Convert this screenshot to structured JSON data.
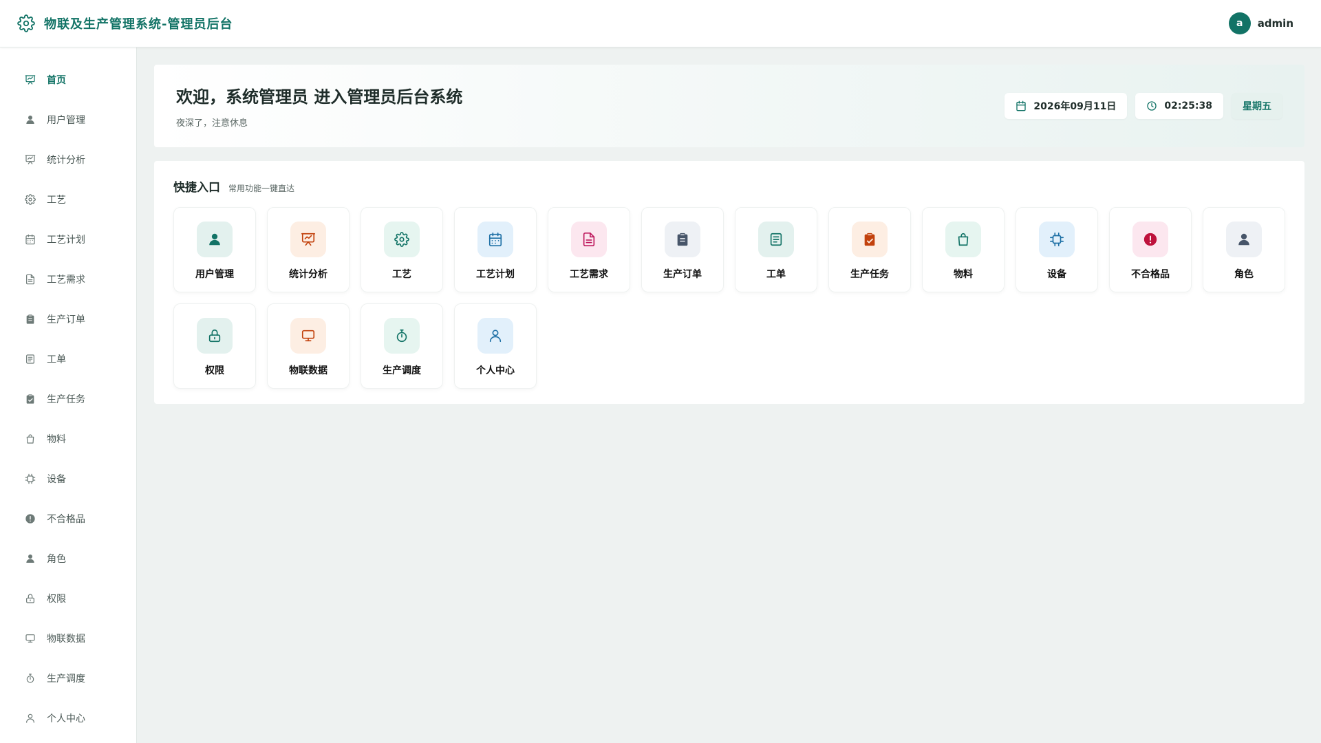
{
  "app": {
    "title": "物联及生产管理系统-管理员后台",
    "logo_icon": "gear-icon"
  },
  "user": {
    "avatar_letter": "a",
    "name": "admin"
  },
  "sidebar": {
    "items": [
      {
        "label": "首页",
        "icon": "presentation-icon",
        "active": true
      },
      {
        "label": "用户管理",
        "icon": "user-icon"
      },
      {
        "label": "统计分析",
        "icon": "presentation-icon"
      },
      {
        "label": "工艺",
        "icon": "gear-icon"
      },
      {
        "label": "工艺计划",
        "icon": "calendar-icon"
      },
      {
        "label": "工艺需求",
        "icon": "document-icon"
      },
      {
        "label": "生产订单",
        "icon": "clipboard-icon"
      },
      {
        "label": "工单",
        "icon": "list-doc-icon"
      },
      {
        "label": "生产任务",
        "icon": "clipboard-check-icon"
      },
      {
        "label": "物料",
        "icon": "bag-icon"
      },
      {
        "label": "设备",
        "icon": "chip-icon"
      },
      {
        "label": "不合格品",
        "icon": "alert-icon"
      },
      {
        "label": "角色",
        "icon": "user-icon"
      },
      {
        "label": "权限",
        "icon": "lock-icon"
      },
      {
        "label": "物联数据",
        "icon": "monitor-icon"
      },
      {
        "label": "生产调度",
        "icon": "stopwatch-icon"
      },
      {
        "label": "个人中心",
        "icon": "user-outline-icon"
      }
    ]
  },
  "welcome": {
    "title": "欢迎，系统管理员 进入管理员后台系统",
    "subtitle": "夜深了，注意休息",
    "date": "2026年09月11日",
    "time": "02:25:38",
    "weekday": "星期五"
  },
  "quick": {
    "title": "快捷入口",
    "subtitle": "常用功能一键直达",
    "items": [
      {
        "label": "用户管理",
        "icon": "user-icon",
        "color": "#127366",
        "bg": "#e3f1ee"
      },
      {
        "label": "统计分析",
        "icon": "presentation-icon",
        "color": "#c2410c",
        "bg": "#fdeee3"
      },
      {
        "label": "工艺",
        "icon": "gear-icon",
        "color": "#127366",
        "bg": "#e6f5f0"
      },
      {
        "label": "工艺计划",
        "icon": "calendar-icon",
        "color": "#1d6fa5",
        "bg": "#e2f0fb"
      },
      {
        "label": "工艺需求",
        "icon": "document-icon",
        "color": "#be185d",
        "bg": "#fce7ef"
      },
      {
        "label": "生产订单",
        "icon": "clipboard-icon",
        "color": "#475569",
        "bg": "#eef1f5"
      },
      {
        "label": "工单",
        "icon": "list-doc-icon",
        "color": "#127366",
        "bg": "#e3f1ee"
      },
      {
        "label": "生产任务",
        "icon": "clipboard-check-icon",
        "color": "#c2410c",
        "bg": "#fdeee3"
      },
      {
        "label": "物料",
        "icon": "bag-icon",
        "color": "#127366",
        "bg": "#e6f5f0"
      },
      {
        "label": "设备",
        "icon": "chip-icon",
        "color": "#1d6fa5",
        "bg": "#e2f0fb"
      },
      {
        "label": "不合格品",
        "icon": "alert-icon",
        "color": "#be123c",
        "bg": "#fce7ef"
      },
      {
        "label": "角色",
        "icon": "user-icon",
        "color": "#475569",
        "bg": "#eef1f5"
      },
      {
        "label": "权限",
        "icon": "lock-icon",
        "color": "#127366",
        "bg": "#e3f1ee"
      },
      {
        "label": "物联数据",
        "icon": "monitor-icon",
        "color": "#c2410c",
        "bg": "#fdeee3"
      },
      {
        "label": "生产调度",
        "icon": "stopwatch-icon",
        "color": "#127366",
        "bg": "#e6f5f0"
      },
      {
        "label": "个人中心",
        "icon": "user-outline-icon",
        "color": "#1d6fa5",
        "bg": "#e2f0fb"
      }
    ]
  },
  "colors": {
    "brand": "#127366",
    "background": "#eef2f1"
  }
}
